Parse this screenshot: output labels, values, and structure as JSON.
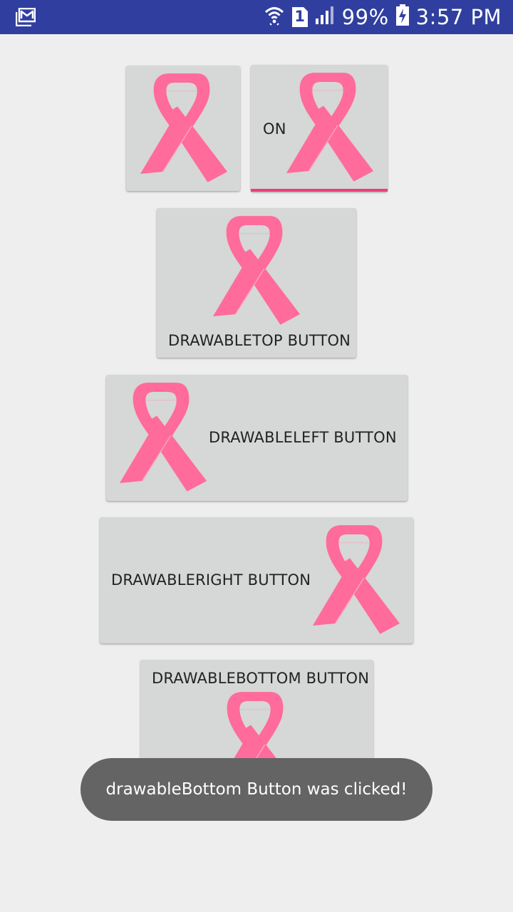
{
  "status_bar": {
    "sim_slot": "1",
    "battery": "99%",
    "time": "3:57 PM",
    "bg_color": "#303f9f"
  },
  "buttons": {
    "image_button": {
      "icon": "pink-ribbon-icon"
    },
    "toggle_button": {
      "label": "ON",
      "icon": "pink-ribbon-icon",
      "accent": "#ec407a"
    },
    "drawable_top": {
      "label": "DRAWABLETOP BUTTON",
      "icon": "pink-ribbon-icon"
    },
    "drawable_left": {
      "label": "DRAWABLELEFT BUTTON",
      "icon": "pink-ribbon-icon"
    },
    "drawable_right": {
      "label": "DRAWABLERIGHT BUTTON",
      "icon": "pink-ribbon-icon"
    },
    "drawable_bottom": {
      "label": "DRAWABLEBOTTOM BUTTON",
      "icon": "pink-ribbon-icon"
    }
  },
  "toast": {
    "message": "drawableBottom Button was clicked!"
  },
  "colors": {
    "ribbon": "#ff6b9b",
    "button_bg": "#d6d7d7",
    "background": "#eeeeee"
  }
}
